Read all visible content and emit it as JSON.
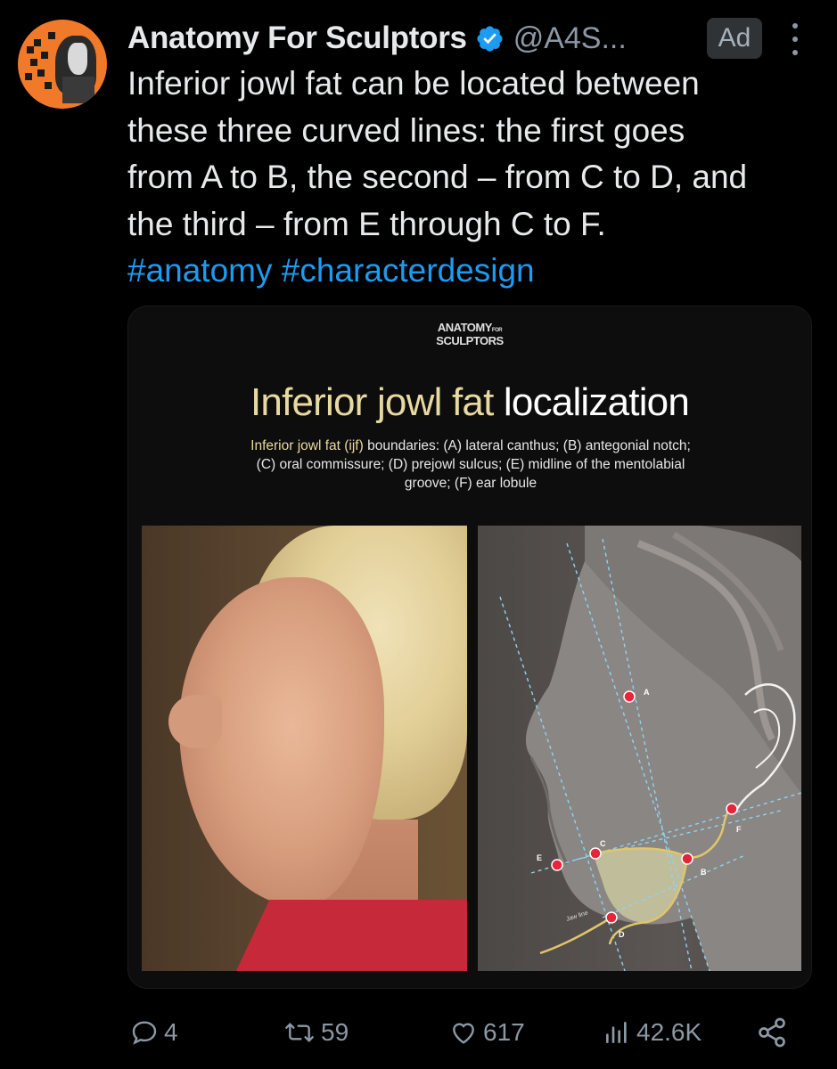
{
  "tweet": {
    "author_name": "Anatomy For Sculptors",
    "handle": "@A4S...",
    "ad_label": "Ad",
    "text_lines": [
      "Inferior jowl fat can be located between",
      "these three curved lines: the first goes",
      "from A to B, the second – from C to D, and",
      "the third – from E through C to F."
    ],
    "hashtags": "#anatomy #characterdesign"
  },
  "media": {
    "brand_line1": "ANATOMY",
    "brand_small": "FOR",
    "brand_line2": "SCULPTORS",
    "title_highlight": "Inferior jowl fat",
    "title_rest": " localization",
    "subtitle_highlight": "Inferior jowl fat (ijf)",
    "subtitle_rest_line1": " boundaries: (A) lateral canthus; (B) antegonial notch;",
    "subtitle_line2": "(C) oral commissure; (D) prejowl sulcus; (E) midline of the mentolabial",
    "subtitle_line3": "groove; (F) ear lobule",
    "labels": {
      "a": "A",
      "b": "B",
      "c": "C",
      "d": "D",
      "e": "E",
      "f": "F",
      "jaw": "Jaw line"
    }
  },
  "actions": {
    "replies": "4",
    "reposts": "59",
    "likes": "617",
    "views": "42.6K"
  },
  "colors": {
    "background": "#000000",
    "text": "#e7e9ea",
    "muted": "#8b98a5",
    "link": "#1d9bf0",
    "verified": "#1d9bf0",
    "accent_point": "#e8233a",
    "jowl_fill": "#c9c7a0"
  },
  "icons": [
    "verified-badge-icon",
    "more-icon",
    "reply-icon",
    "repost-icon",
    "like-icon",
    "views-icon",
    "share-icon"
  ]
}
